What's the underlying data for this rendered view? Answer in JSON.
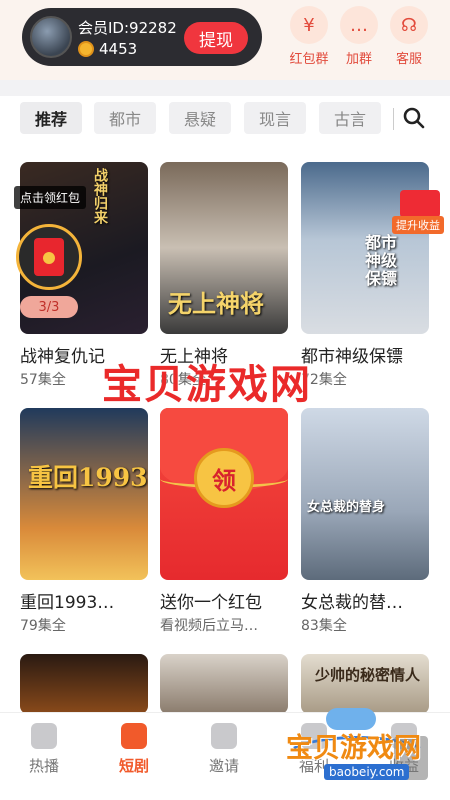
{
  "header": {
    "user_id": "会员ID:92282",
    "coins": "4453",
    "withdraw_label": "提现",
    "actions": [
      {
        "label": "红包群",
        "icon": "red-envelope-icon",
        "glyph": "¥"
      },
      {
        "label": "加群",
        "icon": "group-chat-icon",
        "glyph": "…"
      },
      {
        "label": "客服",
        "icon": "headset-icon",
        "glyph": "☊"
      }
    ]
  },
  "tabs": [
    "推荐",
    "都市",
    "悬疑",
    "现言",
    "古言"
  ],
  "overlays": {
    "claim_tag": "点击领红包",
    "claim_progress": "3/3",
    "boost_label": "提升收益"
  },
  "cards": [
    {
      "title": "战神复仇记",
      "sub": "57集全",
      "poster_text": "战神归来"
    },
    {
      "title": "无上神将",
      "sub": "80集全",
      "poster_text": "无上神将"
    },
    {
      "title": "都市神级保镖",
      "sub": "72集全",
      "poster_text": "都市神级保镖"
    },
    {
      "title": "重回1993…",
      "sub": "79集全",
      "poster_text": "重回1993"
    },
    {
      "title": "送你一个红包",
      "sub": "看视频后立马…",
      "poster_text": "领"
    },
    {
      "title": "女总裁的替…",
      "sub": "83集全",
      "poster_text": "女总裁的替身"
    },
    {
      "title": "",
      "sub": "",
      "poster_text": ""
    },
    {
      "title": "",
      "sub": "",
      "poster_text": ""
    },
    {
      "title": "",
      "sub": "",
      "poster_text": "少帅的秘密情人"
    }
  ],
  "watermark": "宝贝游戏网",
  "bottom_nav": [
    {
      "label": "热播",
      "icon": "fire-icon"
    },
    {
      "label": "短剧",
      "icon": "play-icon"
    },
    {
      "label": "邀请",
      "icon": "plus-icon"
    },
    {
      "label": "福利",
      "icon": "gift-icon"
    },
    {
      "label": "收益",
      "icon": "wallet-icon"
    }
  ],
  "logo_watermark": {
    "text": "宝贝游戏网",
    "url": "baobeiy.com"
  },
  "colors": {
    "accent": "#f15a2b",
    "brand_red": "#f0363e",
    "coin": "#f5b52e"
  }
}
